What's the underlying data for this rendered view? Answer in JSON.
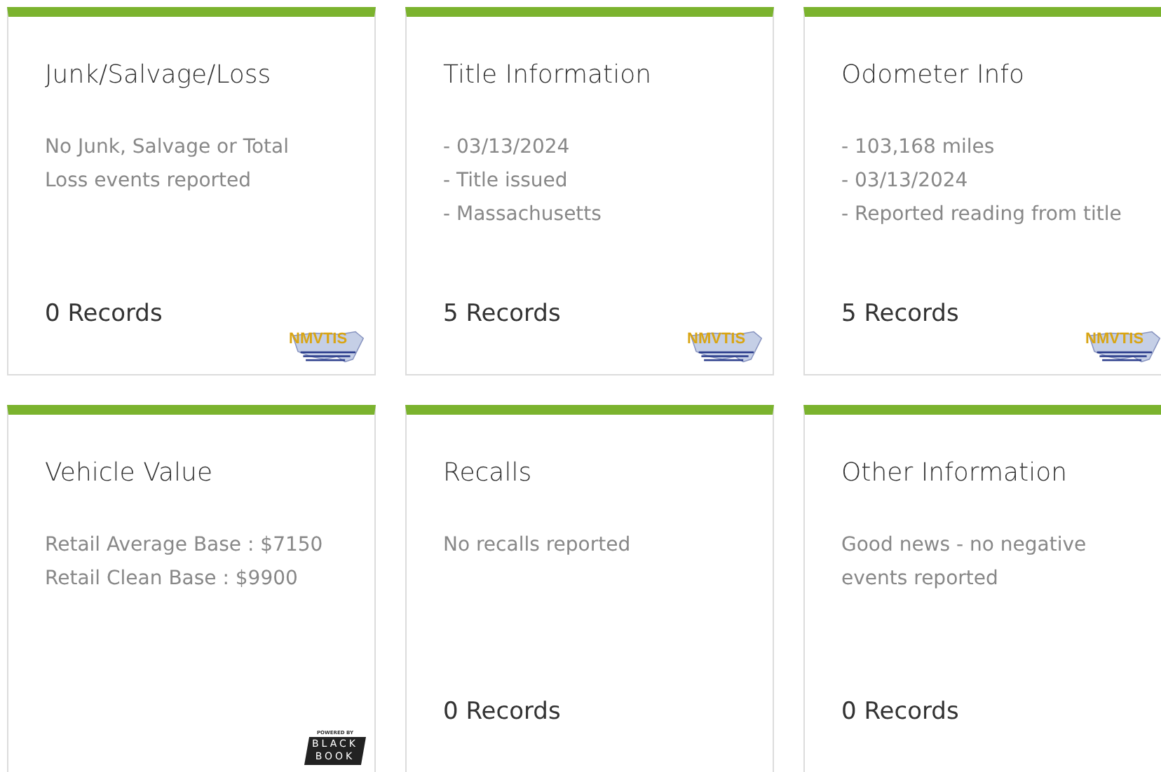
{
  "cards": [
    {
      "title": "Junk/Salvage/Loss",
      "lines": [
        "No Junk, Salvage or Total Loss events reported"
      ],
      "records": "0 Records",
      "logo": {
        "kind": "nmvtis",
        "text": "NMVTIS"
      }
    },
    {
      "title": "Title Information",
      "lines": [
        "- 03/13/2024",
        "- Title issued",
        "- Massachusetts"
      ],
      "records": "5 Records",
      "logo": {
        "kind": "nmvtis",
        "text": "NMVTIS"
      }
    },
    {
      "title": "Odometer Info",
      "lines": [
        "- 103,168 miles",
        "- 03/13/2024",
        "- Reported reading from title"
      ],
      "records": "5 Records",
      "logo": {
        "kind": "nmvtis",
        "text": "NMVTIS"
      }
    },
    {
      "title": "Vehicle Value",
      "lines": [
        "Retail Average Base : $7150",
        "Retail Clean Base : $9900"
      ],
      "logo": {
        "kind": "blackbook",
        "caption": "POWERED BY",
        "words": [
          "BLACK",
          "BOOK"
        ]
      }
    },
    {
      "title": "Recalls",
      "lines": [
        "No recalls reported"
      ],
      "records": "0 Records"
    },
    {
      "title": "Other Information",
      "lines": [
        "Good news - no negative events reported"
      ],
      "records": "0 Records"
    }
  ]
}
